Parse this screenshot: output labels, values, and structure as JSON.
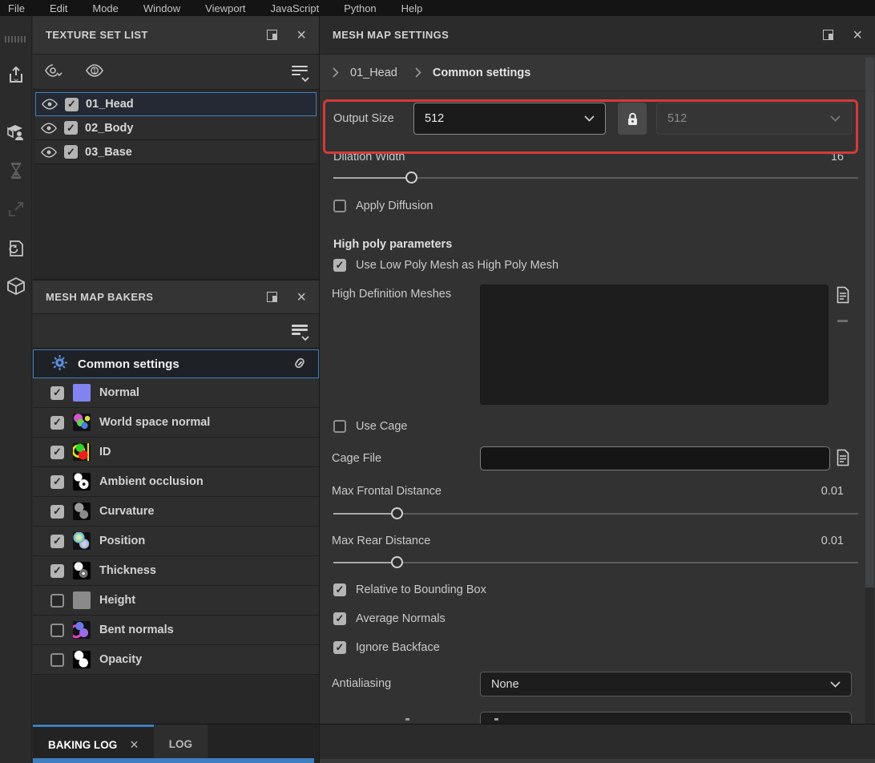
{
  "menu": {
    "items": [
      "File",
      "Edit",
      "Mode",
      "Window",
      "Viewport",
      "JavaScript",
      "Python",
      "Help"
    ]
  },
  "icons": {
    "close_glyph": "×",
    "check_glyph": "✓"
  },
  "left_toolbar": {
    "icons": [
      "export-icon",
      "mesh-person-icon",
      "hourglass-icon",
      "expand-icon",
      "reload-icon",
      "cube-icon"
    ]
  },
  "texture_set_list": {
    "title": "TEXTURE SET LIST",
    "items": [
      {
        "label": "01_Head",
        "checked": true,
        "visible": true,
        "selected": true
      },
      {
        "label": "02_Body",
        "checked": true,
        "visible": true,
        "selected": false
      },
      {
        "label": "03_Base",
        "checked": true,
        "visible": true,
        "selected": false
      }
    ]
  },
  "mesh_map_bakers": {
    "title": "MESH MAP BAKERS",
    "common_settings": {
      "label": "Common settings",
      "selected": true
    },
    "items": [
      {
        "label": "Normal",
        "checked": true
      },
      {
        "label": "World space normal",
        "checked": true
      },
      {
        "label": "ID",
        "checked": true
      },
      {
        "label": "Ambient occlusion",
        "checked": true
      },
      {
        "label": "Curvature",
        "checked": true
      },
      {
        "label": "Position",
        "checked": true
      },
      {
        "label": "Thickness",
        "checked": true
      },
      {
        "label": "Height",
        "checked": false
      },
      {
        "label": "Bent normals",
        "checked": false
      },
      {
        "label": "Opacity",
        "checked": false
      }
    ]
  },
  "mesh_map_settings": {
    "title": "MESH MAP SETTINGS",
    "breadcrumb": {
      "level1": "01_Head",
      "level2": "Common settings"
    },
    "output_size": {
      "label": "Output Size",
      "value": "512",
      "linked_value": "512",
      "locked": true
    },
    "dilation_width": {
      "label": "Dilation Width",
      "value": "16"
    },
    "apply_diffusion": {
      "label": "Apply Diffusion",
      "checked": false
    },
    "high_poly": {
      "heading": "High poly parameters",
      "use_low_poly": {
        "label": "Use Low Poly Mesh as High Poly Mesh",
        "checked": true
      },
      "high_def_meshes": {
        "label": "High Definition Meshes",
        "value": ""
      }
    },
    "use_cage": {
      "label": "Use Cage",
      "checked": false
    },
    "cage_file": {
      "label": "Cage File",
      "value": ""
    },
    "max_frontal": {
      "label": "Max Frontal Distance",
      "value": "0.01"
    },
    "max_rear": {
      "label": "Max Rear Distance",
      "value": "0.01"
    },
    "relative_bb": {
      "label": "Relative to Bounding Box",
      "checked": true
    },
    "average_normals": {
      "label": "Average Normals",
      "checked": true
    },
    "ignore_backface": {
      "label": "Ignore Backface",
      "checked": true
    },
    "antialiasing": {
      "label": "Antialiasing",
      "value": "None"
    }
  },
  "bottom_tabs": {
    "baking_log": "BAKING LOG",
    "log": "LOG"
  },
  "colors": {
    "accent_blue": "#3f7fbf",
    "highlight_red": "#d23b3b",
    "gear_blue": "#5b8dd9"
  }
}
